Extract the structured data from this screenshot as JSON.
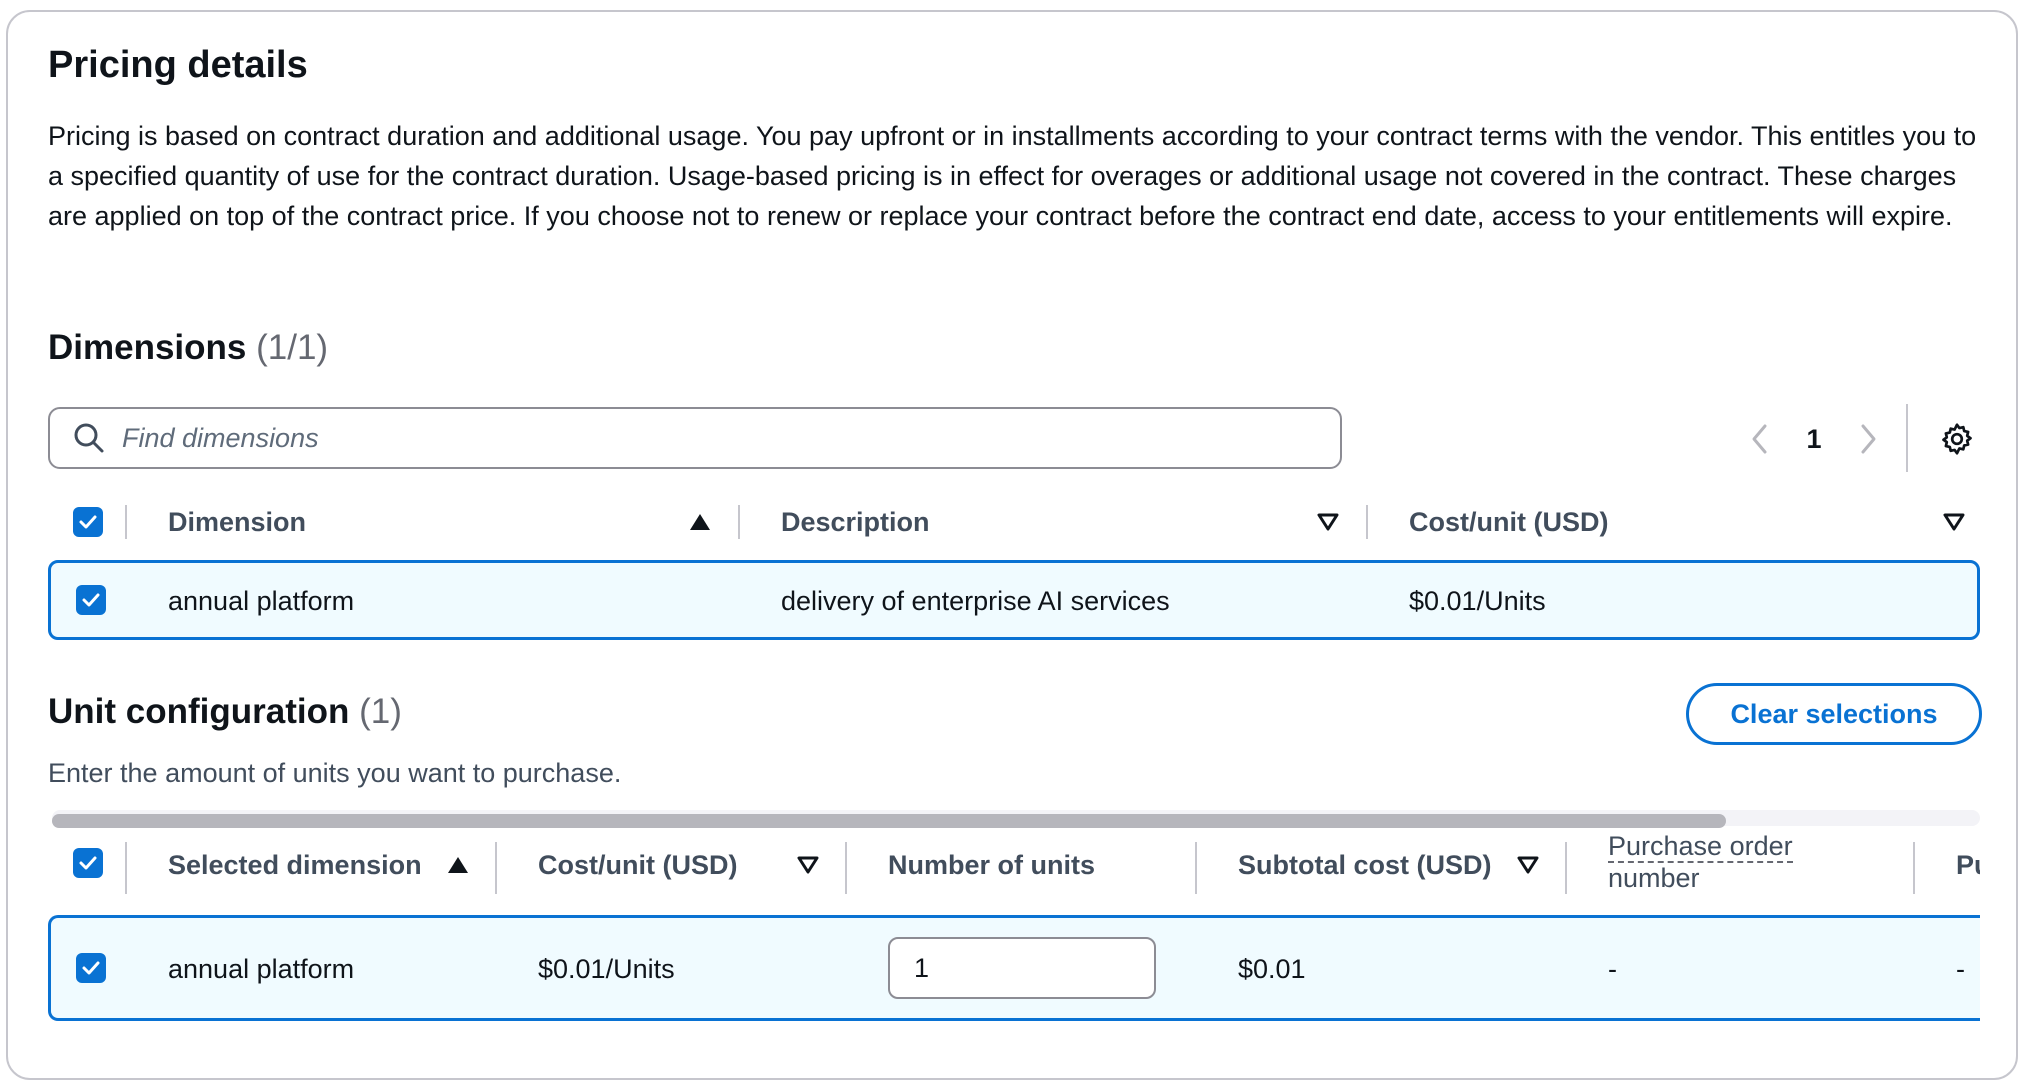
{
  "pricing": {
    "title": "Pricing details",
    "description": "Pricing is based on contract duration and additional usage. You pay upfront or in installments according to your contract terms with the vendor. This entitles you to a specified quantity of use for the contract duration. Usage-based pricing is in effect for overages or additional usage not covered in the contract. These charges are applied on top of the contract price. If you choose not to renew or replace your contract before the contract end date, access to your entitlements will expire."
  },
  "dimensions": {
    "heading": "Dimensions",
    "count": "(1/1)",
    "search_placeholder": "Find dimensions",
    "page": "1",
    "columns": [
      "Dimension",
      "Description",
      "Cost/unit (USD)"
    ],
    "sort_state": {
      "Dimension": "ascending",
      "Description": "none",
      "Cost/unit (USD)": "none"
    },
    "rows": [
      {
        "dimension": "annual platform",
        "description": "delivery of enterprise AI services",
        "cost": "$0.01/Units",
        "selected": true
      }
    ]
  },
  "unit_config": {
    "heading": "Unit configuration",
    "count": "(1)",
    "subtitle": "Enter the amount of units you want to purchase.",
    "clear_label": "Clear selections",
    "columns": [
      "Selected dimension",
      "Cost/unit (USD)",
      "Number of units",
      "Subtotal cost (USD)",
      "Purchase order number",
      "Pu"
    ],
    "rows": [
      {
        "dimension": "annual platform",
        "cost": "$0.01/Units",
        "units": "1",
        "subtotal": "$0.01",
        "po_number": "-",
        "extra": "-",
        "selected": true
      }
    ]
  },
  "colors": {
    "accent": "#0972d3",
    "selected_row_bg": "#f0fbff",
    "border": "#c6c6cd"
  },
  "icons": [
    "search-icon",
    "chevron-left-icon",
    "chevron-right-icon",
    "gear-icon",
    "checkbox-checked-icon",
    "sort-ascending-icon",
    "sort-descending-icon"
  ]
}
